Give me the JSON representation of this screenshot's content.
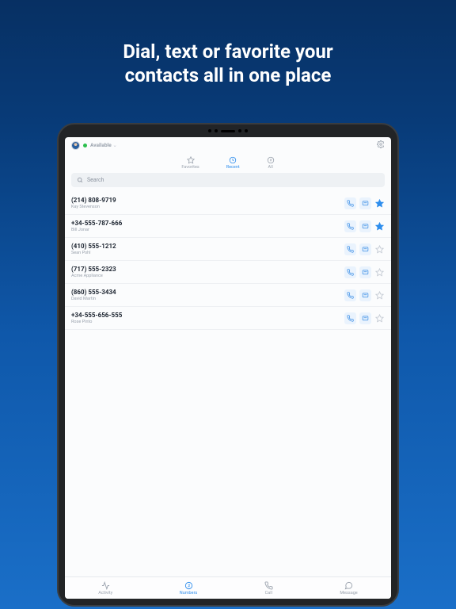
{
  "headline_l1": "Dial, text or favorite your",
  "headline_l2": "contacts all in one place",
  "status": {
    "name": "Available"
  },
  "tabs": {
    "fav": "Favorites",
    "recent": "Recent",
    "all": "All"
  },
  "search": {
    "placeholder": "Search"
  },
  "contacts": [
    {
      "num": "(214) 808-9719",
      "name": "Kay Stevenson",
      "fav": true
    },
    {
      "num": "+34-555-787-666",
      "name": "Bill Jonar",
      "fav": true
    },
    {
      "num": "(410) 555-1212",
      "name": "Sean Pohl",
      "fav": false
    },
    {
      "num": "(717) 555-2323",
      "name": "Acme Appliance",
      "fav": false
    },
    {
      "num": "(860) 555-3434",
      "name": "David Martin",
      "fav": false
    },
    {
      "num": "+34-555-656-555",
      "name": "Rose Pinto",
      "fav": false
    }
  ],
  "bottom": {
    "activity": "Activity",
    "numbers": "Numbers",
    "call": "Call",
    "message": "Message"
  }
}
